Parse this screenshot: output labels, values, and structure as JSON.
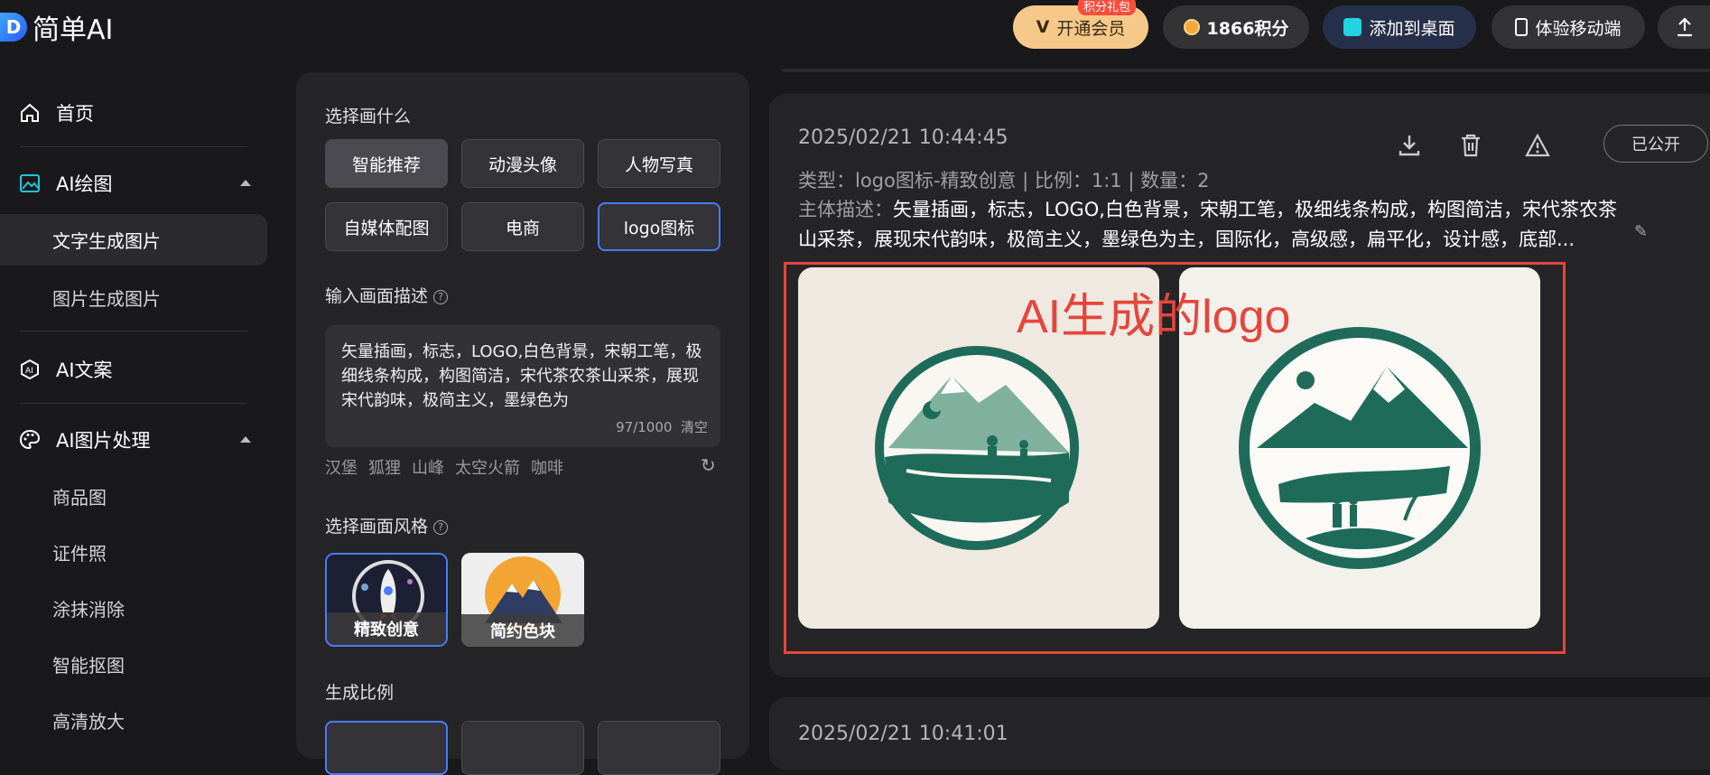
{
  "header": {
    "brand": "简单AI",
    "vip_label": "开通会员",
    "vip_badge": "积分礼包",
    "points_label": "1866积分",
    "desktop_label": "添加到桌面",
    "mobile_label": "体验移动端"
  },
  "sidebar": {
    "home": "首页",
    "ai_draw": "AI绘图",
    "text_to_image": "文字生成图片",
    "image_to_image": "图片生成图片",
    "ai_copy": "AI文案",
    "ai_image_proc": "AI图片处理",
    "product": "商品图",
    "id_photo": "证件照",
    "erase": "涂抹消除",
    "cutout": "智能抠图",
    "upscale": "高清放大"
  },
  "panel": {
    "choose_title": "选择画什么",
    "categories": [
      "智能推荐",
      "动漫头像",
      "人物写真",
      "自媒体配图",
      "电商",
      "logo图标"
    ],
    "desc_title": "输入画面描述",
    "desc_text": "矢量插画，标志，LOGO,白色背景，宋朝工笔，极细线条构成，构图简洁，宋代茶农茶山采茶，展现宋代韵味，极简主义，墨绿色为",
    "desc_count": "97/1000",
    "desc_clear": "清空",
    "tags": [
      "汉堡",
      "狐狸",
      "山峰",
      "太空火箭",
      "咖啡"
    ],
    "style_title": "选择画面风格",
    "styles": [
      "精致创意",
      "简约色块"
    ],
    "ratio_title": "生成比例"
  },
  "result": {
    "date": "2025/02/21 10:44:45",
    "meta": "类型：logo图标-精致创意 | 比例：1:1 | 数量：2",
    "subject_label": "主体描述：",
    "subject_text": "矢量插画，标志，LOGO,白色背景，宋朝工笔，极细线条构成，构图简洁，宋代茶农茶山采茶，展现宋代韵味，极简主义，墨绿色为主，国际化，高级感，扁平化，设计感，底部...",
    "public_label": "已公开",
    "annotation": "AI生成的logo",
    "next_date": "2025/02/21 10:41:01"
  },
  "colors": {
    "accent_blue": "#4a7bff",
    "annotation_red": "#e6453c",
    "logo_green": "#1f6b5a"
  }
}
